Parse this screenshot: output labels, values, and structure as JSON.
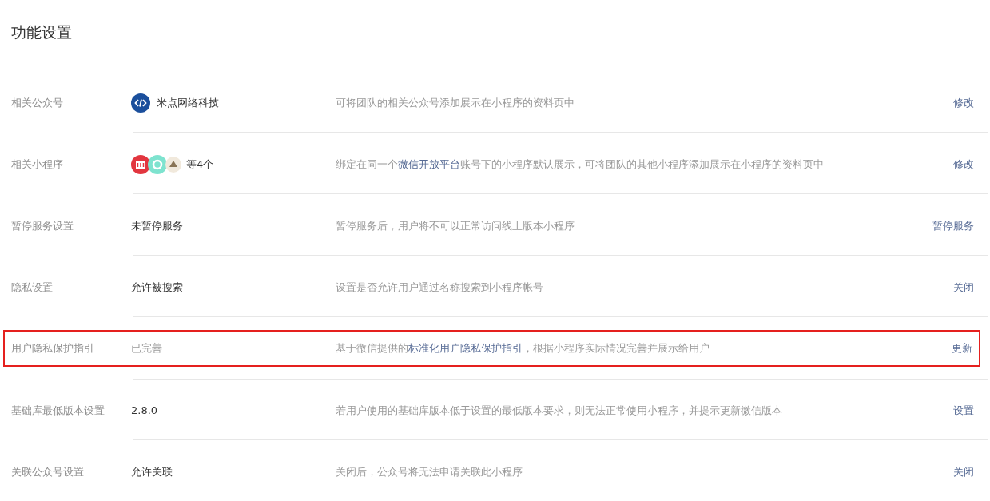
{
  "title": "功能设置",
  "rows": [
    {
      "label": "相关公众号",
      "value": "米点网络科技",
      "kind": "account",
      "value_muted": false,
      "highlighted": false,
      "description": [
        {
          "kind": "text",
          "text": "可将团队的相关公众号添加展示在小程序的资料页中"
        }
      ],
      "action": "修改"
    },
    {
      "label": "相关小程序",
      "value": "等4个",
      "kind": "apps",
      "value_muted": false,
      "highlighted": false,
      "description": [
        {
          "kind": "text",
          "text": "绑定在同一个"
        },
        {
          "kind": "link",
          "text": "微信开放平台"
        },
        {
          "kind": "text",
          "text": "账号下的小程序默认展示，可将团队的其他小程序添加展示在小程序的资料页中"
        }
      ],
      "action": "修改"
    },
    {
      "label": "暂停服务设置",
      "value": "未暂停服务",
      "kind": "text",
      "value_muted": false,
      "highlighted": false,
      "description": [
        {
          "kind": "text",
          "text": "暂停服务后，用户将不可以正常访问线上版本小程序"
        }
      ],
      "action": "暂停服务"
    },
    {
      "label": "隐私设置",
      "value": "允许被搜索",
      "kind": "text",
      "value_muted": false,
      "highlighted": false,
      "description": [
        {
          "kind": "text",
          "text": "设置是否允许用户通过名称搜索到小程序帐号"
        }
      ],
      "action": "关闭"
    },
    {
      "label": "用户隐私保护指引",
      "value": "已完善",
      "kind": "text",
      "value_muted": true,
      "highlighted": true,
      "description": [
        {
          "kind": "text",
          "text": "基于微信提供的"
        },
        {
          "kind": "link",
          "text": "标准化用户隐私保护指引"
        },
        {
          "kind": "text",
          "text": "，根据小程序实际情况完善并展示给用户"
        }
      ],
      "action": "更新"
    },
    {
      "label": "基础库最低版本设置",
      "value": "2.8.0",
      "kind": "text",
      "value_muted": false,
      "highlighted": false,
      "description": [
        {
          "kind": "text",
          "text": "若用户使用的基础库版本低于设置的最低版本要求，则无法正常使用小程序，并提示更新微信版本"
        }
      ],
      "action": "设置"
    },
    {
      "label": "关联公众号设置",
      "value": "允许关联",
      "kind": "text",
      "value_muted": false,
      "highlighted": false,
      "description": [
        {
          "kind": "text",
          "text": "关闭后，公众号将无法申请关联此小程序"
        }
      ],
      "action": "关闭"
    }
  ]
}
